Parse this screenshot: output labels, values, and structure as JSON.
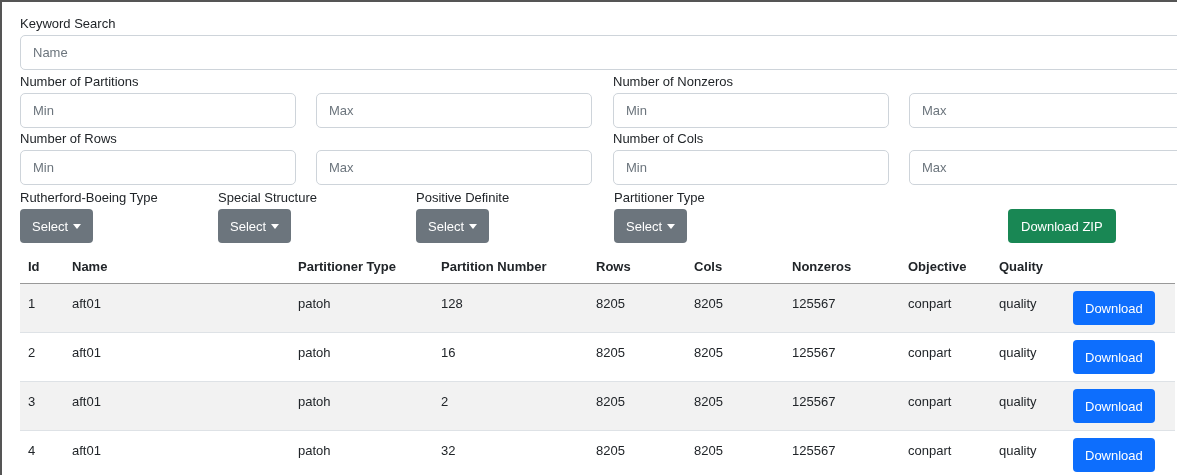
{
  "keyword_search": {
    "label": "Keyword Search",
    "placeholder": "Name"
  },
  "range_filters": [
    {
      "label": "Number of Partitions",
      "min_placeholder": "Min",
      "max_placeholder": "Max"
    },
    {
      "label": "Number of Nonzeros",
      "min_placeholder": "Min",
      "max_placeholder": "Max"
    },
    {
      "label": "Number of Rows",
      "min_placeholder": "Min",
      "max_placeholder": "Max"
    },
    {
      "label": "Number of Cols",
      "min_placeholder": "Min",
      "max_placeholder": "Max"
    }
  ],
  "dropdowns": [
    {
      "label": "Rutherford-Boeing Type",
      "button": "Select"
    },
    {
      "label": "Special Structure",
      "button": "Select"
    },
    {
      "label": "Positive Definite",
      "button": "Select"
    },
    {
      "label": "Partitioner Type",
      "button": "Select"
    }
  ],
  "download_zip": "Download ZIP",
  "table": {
    "columns": [
      "Id",
      "Name",
      "Partitioner Type",
      "Partition Number",
      "Rows",
      "Cols",
      "Nonzeros",
      "Objective",
      "Quality"
    ],
    "rows": [
      {
        "cells": [
          "1",
          "aft01",
          "patoh",
          "128",
          "8205",
          "8205",
          "125567",
          "conpart",
          "quality"
        ],
        "button": "Download"
      },
      {
        "cells": [
          "2",
          "aft01",
          "patoh",
          "16",
          "8205",
          "8205",
          "125567",
          "conpart",
          "quality"
        ],
        "button": "Download"
      },
      {
        "cells": [
          "3",
          "aft01",
          "patoh",
          "2",
          "8205",
          "8205",
          "125567",
          "conpart",
          "quality"
        ],
        "button": "Download"
      },
      {
        "cells": [
          "4",
          "aft01",
          "patoh",
          "32",
          "8205",
          "8205",
          "125567",
          "conpart",
          "quality"
        ],
        "button": "Download"
      }
    ]
  }
}
